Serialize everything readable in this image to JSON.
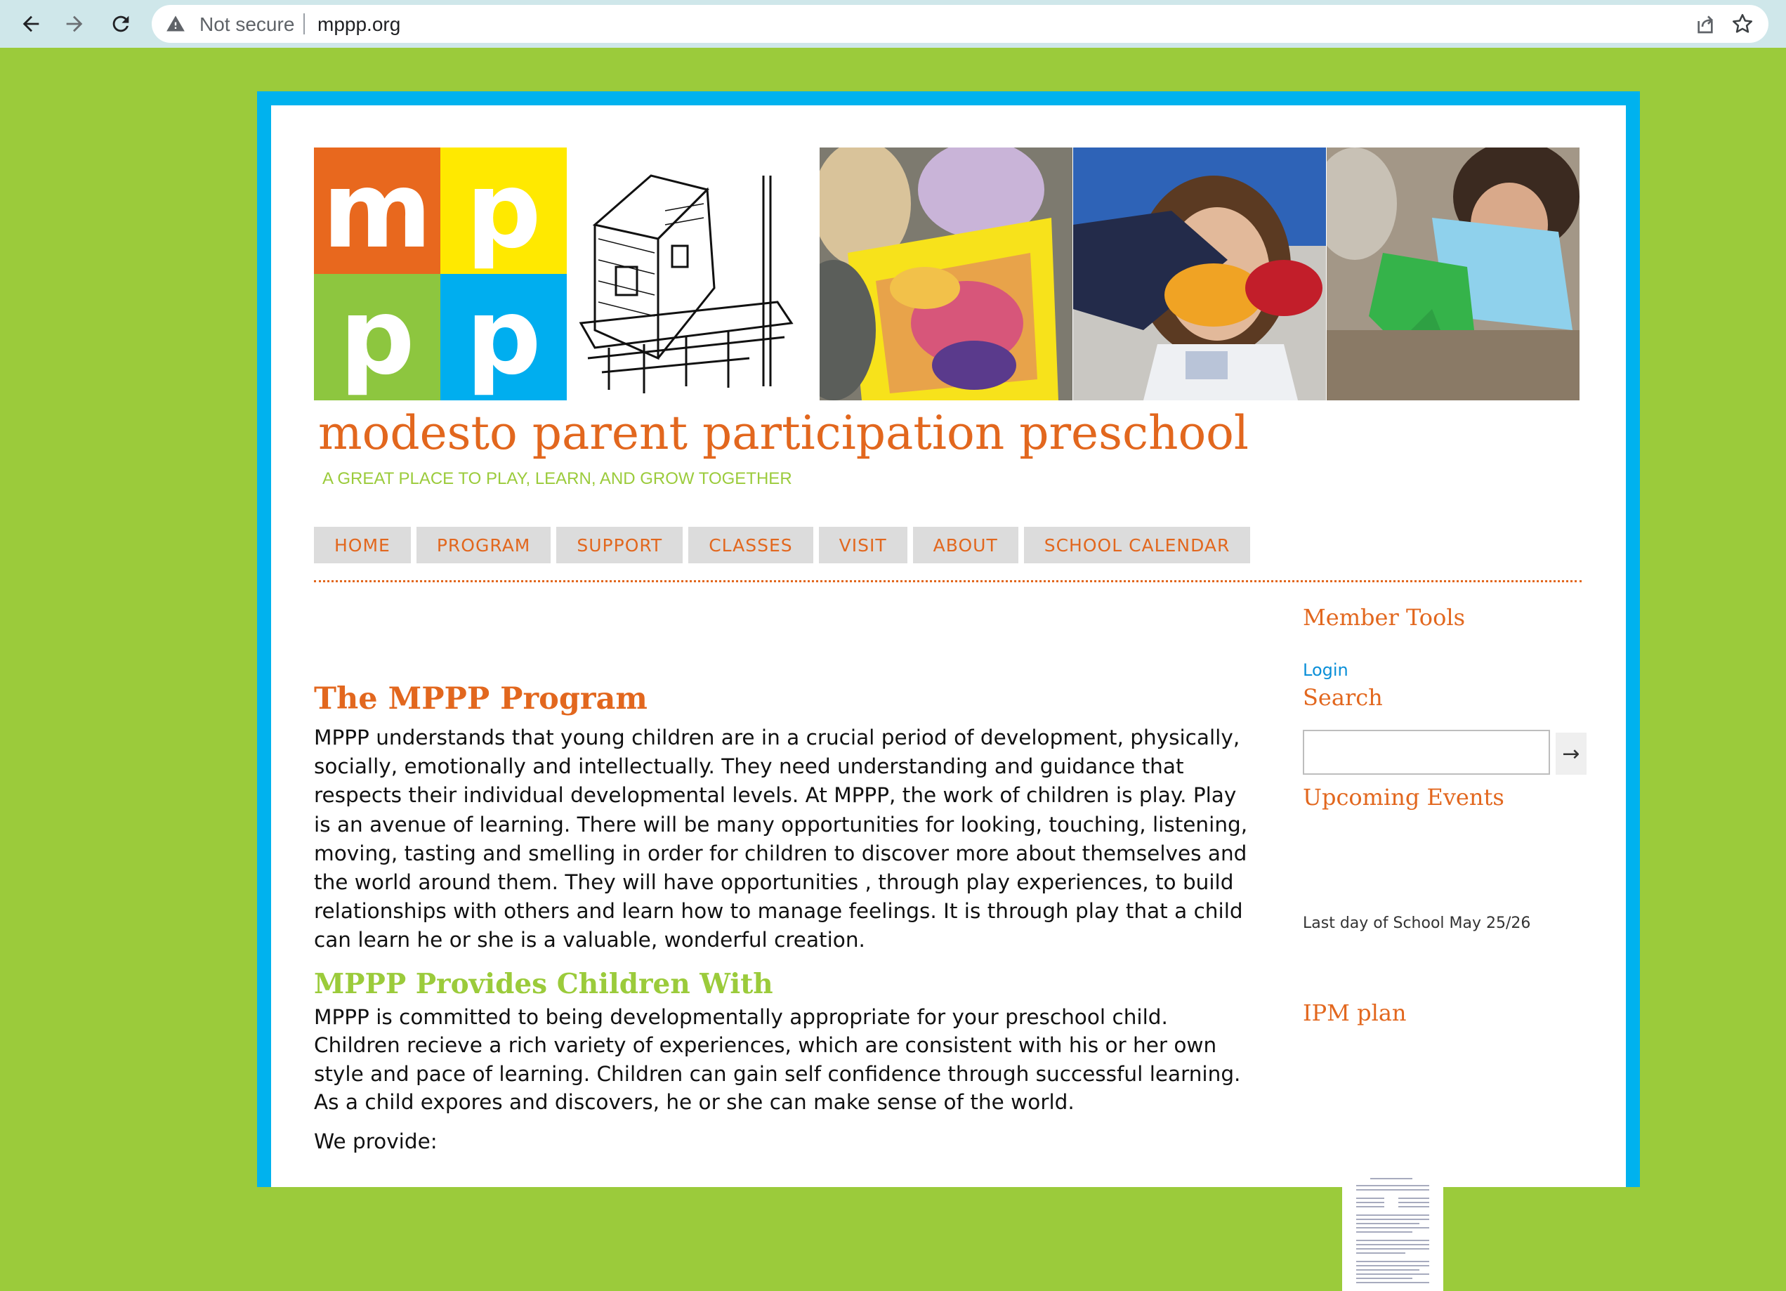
{
  "browser": {
    "security_label": "Not secure",
    "url": "mppp.org"
  },
  "colors": {
    "page_bg": "#9bcb3b",
    "frame_border": "#00b2ee",
    "accent_orange": "#e2671e",
    "accent_green": "#9bcb3b",
    "link_blue": "#0a8fd8"
  },
  "header": {
    "logo_letters": [
      "m",
      "p",
      "p",
      "p"
    ],
    "school_name": "modesto parent participation preschool",
    "tagline": "A GREAT PLACE TO PLAY, LEARN, AND GROW TOGETHER"
  },
  "menu": {
    "items": [
      {
        "label": "HOME"
      },
      {
        "label": "PROGRAM"
      },
      {
        "label": "SUPPORT"
      },
      {
        "label": "CLASSES"
      },
      {
        "label": "VISIT"
      },
      {
        "label": "ABOUT"
      },
      {
        "label": "SCHOOL CALENDAR"
      }
    ]
  },
  "main": {
    "title": "The MPPP Program",
    "intro": "MPPP understands that young children are in a crucial period of development, physically, socially, emotionally and intellectually. They need understanding and guidance that respects their individual developmental levels. At MPPP, the work of children is play. Play is an avenue of learning. There will be many opportunities for looking, touching, listening, moving, tasting and smelling in order for children to discover more about themselves and the world around them. They will have opportunities , through play experiences, to build relationships with others and learn how to manage feelings. It is through play that a child can learn he or she is a valuable, wonderful creation.",
    "provides_heading": "MPPP Provides Children With",
    "provides_text": "MPPP is committed to being developmentally appropriate for your preschool child. Children recieve a rich variety of experiences, which are consistent with his or her own style and pace of learning. Children can gain self confidence through successful learning. As a child expores and discovers, he or she can make sense of the world.",
    "we_provide": "We provide:"
  },
  "sidebar": {
    "member_tools_heading": "Member Tools",
    "login_label": "Login",
    "search_heading": "Search",
    "search_value": "",
    "search_button_label": "→",
    "events_heading": "Upcoming Events",
    "event_text": "Last day of School May 25/26",
    "ipm_heading": "IPM plan"
  }
}
